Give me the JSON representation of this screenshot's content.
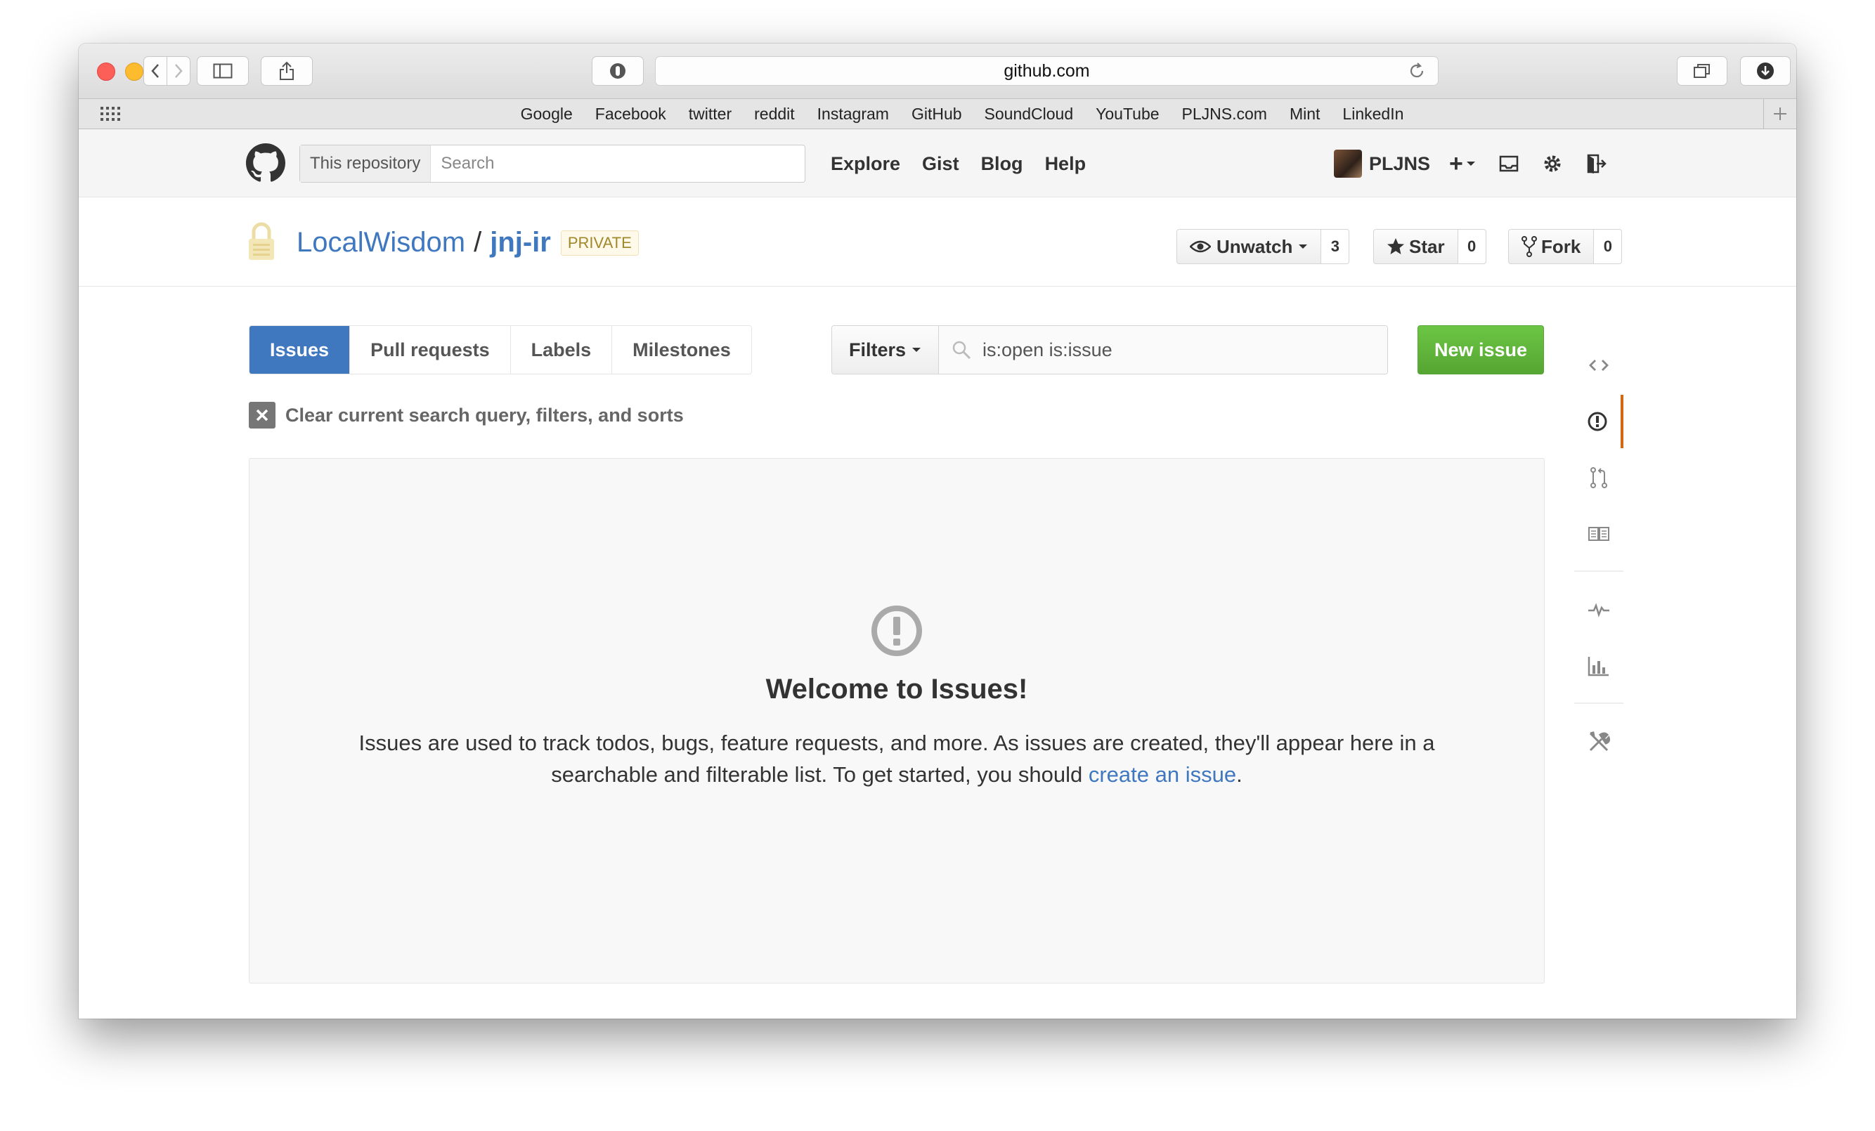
{
  "browser": {
    "url": "github.com",
    "bookmarks": [
      "Google",
      "Facebook",
      "twitter",
      "reddit",
      "Instagram",
      "GitHub",
      "SoundCloud",
      "YouTube",
      "PLJNS.com",
      "Mint",
      "LinkedIn"
    ]
  },
  "header": {
    "search_scope": "This repository",
    "search_placeholder": "Search",
    "nav": [
      "Explore",
      "Gist",
      "Blog",
      "Help"
    ],
    "username": "PLJNS",
    "plus_label": "+"
  },
  "repo": {
    "owner": "LocalWisdom",
    "separator": "/",
    "name": "jnj-ir",
    "visibility": "PRIVATE",
    "watch_label": "Unwatch",
    "watch_count": "3",
    "star_label": "Star",
    "star_count": "0",
    "fork_label": "Fork",
    "fork_count": "0"
  },
  "issues": {
    "tabs": [
      "Issues",
      "Pull requests",
      "Labels",
      "Milestones"
    ],
    "selected_tab": "Issues",
    "filters_label": "Filters",
    "query": "is:open is:issue",
    "new_issue_label": "New issue",
    "clear_label": "Clear current search query, filters, and sorts",
    "blank_title": "Welcome to Issues!",
    "blank_text_before": "Issues are used to track todos, bugs, feature requests, and more. As issues are created, they'll appear here in a searchable and filterable list. To get started, you should ",
    "blank_link": "create an issue",
    "blank_text_after": "."
  },
  "colors": {
    "accent": "#4078c0",
    "new_issue_green": "#6cc644",
    "sidebar_selected": "#d26911",
    "private_badge": "#a1882b"
  },
  "sidebar_icons": [
    "code-icon",
    "issue-opened-icon",
    "pull-request-icon",
    "book-icon",
    "pulse-icon",
    "graph-icon",
    "tools-icon"
  ]
}
